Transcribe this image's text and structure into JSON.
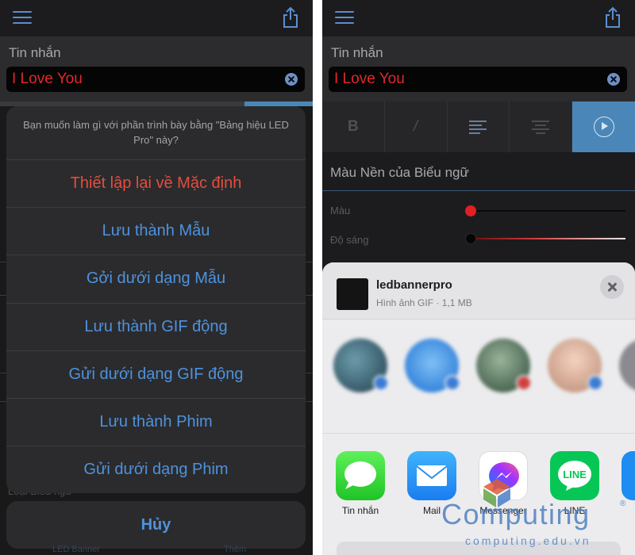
{
  "left": {
    "message_label": "Tin nhắn",
    "message_value": "I Love You",
    "action_sheet": {
      "title": "Bạn muốn làm gì với phần trình bày bằng \"Bảng hiệu LED Pro\" này?",
      "items": [
        "Thiết lập lại về Mặc định",
        "Lưu thành Mẫu",
        "Gởi dưới dạng Mẫu",
        "Lưu thành GIF động",
        "Gửi dưới dạng GIF động",
        "Lưu thành Phim",
        "Gửi dưới dạng Phim"
      ],
      "cancel": "Hủy"
    },
    "background_hint": "Loại Biểu ngữ",
    "tabs": [
      "LED Banner",
      "Thêm"
    ]
  },
  "right": {
    "message_label": "Tin nhắn",
    "message_value": "I Love You",
    "format_buttons": {
      "bold": "B",
      "italic": "/"
    },
    "banner_bg_heading": "Màu Nền của Biểu ngữ",
    "color_label": "Màu",
    "brightness_label": "Độ sáng",
    "share": {
      "file_name": "ledbannerpro",
      "file_meta": "Hình ảnh GIF · 1,1 MB",
      "apps": [
        {
          "label": "Tin nhắn",
          "icon": "messages-icon"
        },
        {
          "label": "Mail",
          "icon": "mail-icon"
        },
        {
          "label": "Messenger",
          "icon": "messenger-icon"
        },
        {
          "label": "LINE",
          "icon": "line-icon",
          "glyph": "LINE"
        }
      ]
    }
  },
  "watermark": {
    "brand": "Computing",
    "reg": "®",
    "url": "computing.edu.vn"
  }
}
